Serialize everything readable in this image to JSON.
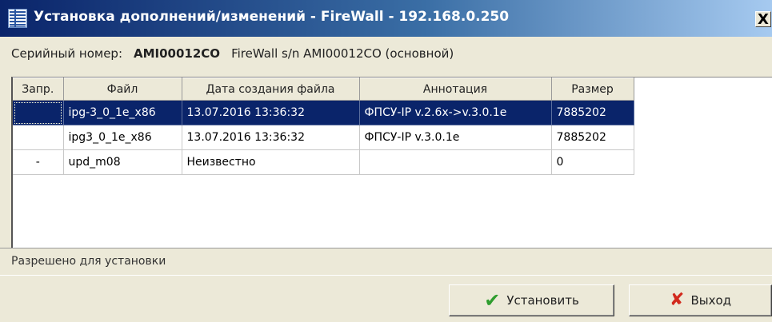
{
  "window": {
    "title": "Установка дополнений/изменений - FireWall - 192.168.0.250",
    "close_label": "X"
  },
  "serial": {
    "label": "Серийный номер:",
    "value": "AMI00012CO",
    "description": "FireWall s/n AMI00012CO (основной)"
  },
  "grid": {
    "columns": [
      "Запр.",
      "Файл",
      "Дата создания файла",
      "Аннотация",
      "Размер"
    ],
    "rows": [
      {
        "flag": "",
        "file": "ipg-3_0_1e_x86",
        "date": "13.07.2016 13:36:32",
        "note": "ФПСУ-IP v.2.6x->v.3.0.1e",
        "size": "7885202"
      },
      {
        "flag": "",
        "file": "ipg3_0_1e_x86",
        "date": "13.07.2016 13:36:32",
        "note": "ФПСУ-IP v.3.0.1e",
        "size": "7885202"
      },
      {
        "flag": "-",
        "file": "upd_m08",
        "date": "Неизвестно",
        "note": "",
        "size": "0"
      }
    ]
  },
  "status": {
    "text": "Разрешено для установки"
  },
  "buttons": {
    "install_label": "Установить",
    "exit_label": "Выход"
  },
  "colors": {
    "selection": "#0a246a",
    "check_icon": "#2e9d2e",
    "cross_icon": "#d22a1e"
  }
}
